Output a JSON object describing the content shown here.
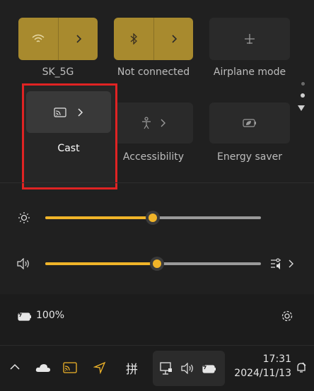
{
  "tiles": {
    "wifi": {
      "label": "SK_5G"
    },
    "bluetooth": {
      "label": "Not connected"
    },
    "airplane": {
      "label": "Airplane mode"
    },
    "cast": {
      "label": "Cast"
    },
    "accessibility": {
      "label": "Accessibility"
    },
    "energy": {
      "label": "Energy saver"
    }
  },
  "sliders": {
    "brightness": {
      "level_percent": 50
    },
    "volume": {
      "level_percent": 51
    }
  },
  "battery": {
    "text": "100%"
  },
  "taskbar": {
    "ime": "拼",
    "time": "17:31",
    "date": "2024/11/13"
  },
  "colors": {
    "accent": "#f0b429",
    "tile_on": "#a88a2e",
    "highlight_border": "#e02323"
  }
}
